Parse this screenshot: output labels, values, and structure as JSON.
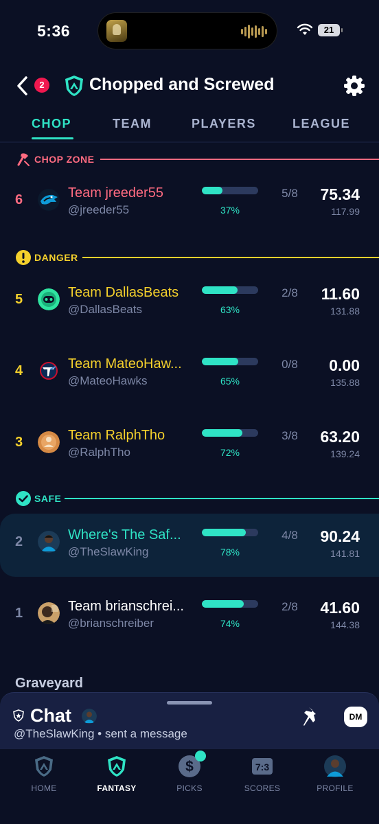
{
  "status": {
    "time": "5:36",
    "battery": "21"
  },
  "header": {
    "badge_count": "2",
    "title": "Chopped and Screwed"
  },
  "tabs": [
    {
      "label": "CHOP",
      "active": true
    },
    {
      "label": "TEAM",
      "active": false
    },
    {
      "label": "PLAYERS",
      "active": false
    },
    {
      "label": "LEAGUE",
      "active": false
    }
  ],
  "sections": {
    "chop_zone": {
      "label": "CHOP ZONE",
      "color": "#ff6b81"
    },
    "danger": {
      "label": "DANGER",
      "color": "#f4d02c"
    },
    "safe": {
      "label": "SAFE",
      "color": "#2fe3c5"
    }
  },
  "standings": [
    {
      "rank": "6",
      "team": "Team jreeder55",
      "handle": "@jreeder55",
      "progress": 0.37,
      "pct": "37%",
      "slots": "5/8",
      "score": "75.34",
      "projected": "117.99",
      "zone": "chop_zone",
      "avatar": "panthers-logo"
    },
    {
      "rank": "5",
      "team": "Team DallasBeats",
      "handle": "@DallasBeats",
      "progress": 0.63,
      "pct": "63%",
      "slots": "2/8",
      "score": "11.60",
      "projected": "131.88",
      "zone": "danger",
      "avatar": "green-robot-avatar"
    },
    {
      "rank": "4",
      "team": "Team MateoHaw...",
      "handle": "@MateoHawks",
      "progress": 0.65,
      "pct": "65%",
      "slots": "0/8",
      "score": "0.00",
      "projected": "135.88",
      "zone": "danger",
      "avatar": "titans-logo"
    },
    {
      "rank": "3",
      "team": "Team RalphTho",
      "handle": "@RalphTho",
      "progress": 0.72,
      "pct": "72%",
      "slots": "3/8",
      "score": "63.20",
      "projected": "139.24",
      "zone": "danger",
      "avatar": "orange-avatar"
    },
    {
      "rank": "2",
      "team": "Where's The Saf...",
      "handle": "@TheSlawKing",
      "progress": 0.78,
      "pct": "78%",
      "slots": "4/8",
      "score": "90.24",
      "projected": "141.81",
      "zone": "safe",
      "avatar": "player-photo",
      "highlight": true
    },
    {
      "rank": "1",
      "team": "Team brianschrei...",
      "handle": "@brianschreiber",
      "progress": 0.74,
      "pct": "74%",
      "slots": "2/8",
      "score": "41.60",
      "projected": "144.38",
      "zone": "safe",
      "avatar": "user-photo"
    }
  ],
  "graveyard_label": "Graveyard",
  "chat": {
    "title": "Chat",
    "subtitle": "@TheSlawKing • sent a message",
    "dm_label": "DM"
  },
  "bottom_nav": [
    {
      "label": "HOME",
      "icon": "shield-logo-icon",
      "active": false
    },
    {
      "label": "FANTASY",
      "icon": "shield-logo-icon",
      "active": true
    },
    {
      "label": "PICKS",
      "icon": "dollar-icon",
      "active": false,
      "dot": true
    },
    {
      "label": "SCORES",
      "icon": "scoreboard-icon",
      "active": false,
      "score_text": "7:3"
    },
    {
      "label": "PROFILE",
      "icon": "profile-avatar-icon",
      "active": false
    }
  ],
  "colors": {
    "accent": "#2fe3c5",
    "danger": "#f4d02c",
    "chop": "#ff6b81",
    "safe_text": "#2fe3c5",
    "muted": "#7d87a6",
    "background": "#0b1024"
  }
}
